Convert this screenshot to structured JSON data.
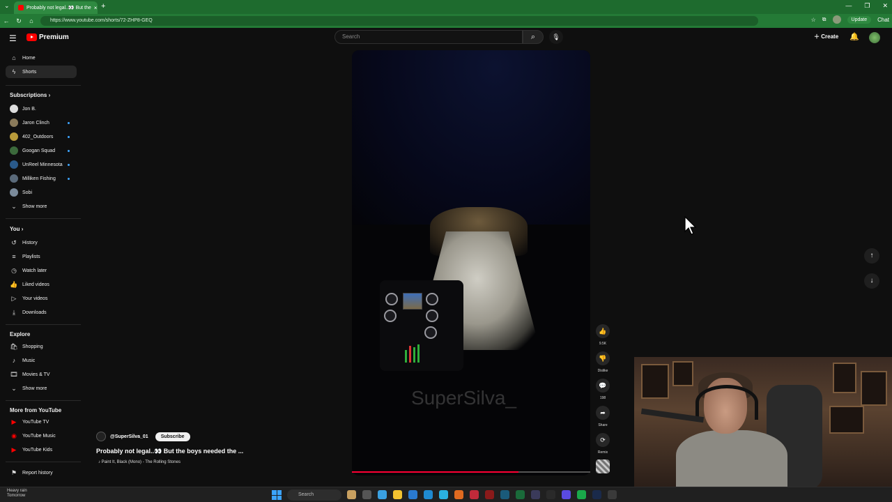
{
  "browser": {
    "tab_title": "Probably not legal..👀 But the",
    "tab_close": "×",
    "new_tab": "+",
    "url": "https://www.youtube.com/shorts/72-ZHP8-GEQ",
    "update_label": "Update",
    "chat_label": "Chat"
  },
  "header": {
    "logo_text": "Premium",
    "search_placeholder": "Search",
    "create_label": "Create"
  },
  "sidebar": {
    "home": "Home",
    "shorts": "Shorts",
    "subscriptions_title": "Subscriptions",
    "subscriptions": [
      {
        "name": "Jon B.",
        "dot": false
      },
      {
        "name": "Jaron Clinch",
        "dot": true
      },
      {
        "name": "402_Outdoors",
        "dot": true
      },
      {
        "name": "Googan Squad",
        "dot": true
      },
      {
        "name": "UnReel Minnesota",
        "dot": true
      },
      {
        "name": "Milliken Fishing",
        "dot": true
      },
      {
        "name": "Sobi",
        "dot": false
      }
    ],
    "show_more": "Show more",
    "you_title": "You",
    "you_items": [
      "History",
      "Playlists",
      "Watch later",
      "Liked videos",
      "Your videos",
      "Downloads"
    ],
    "explore_title": "Explore",
    "explore_items": [
      "Shopping",
      "Music",
      "Movies & TV"
    ],
    "explore_show_more": "Show more",
    "more_title": "More from YouTube",
    "more_items": [
      "YouTube TV",
      "YouTube Music",
      "YouTube Kids"
    ],
    "report_history": "Report history"
  },
  "short": {
    "watermark": "SuperSilva_",
    "channel": "@SuperSilva_01",
    "subscribe": "Subscribe",
    "title": "Probably not legal..👀 But the boys needed the ...",
    "song": "Paint It, Black (Mono) - The Rolling Stones",
    "progress": 0.7
  },
  "actions": {
    "likes": "9.5K",
    "dislike": "Dislike",
    "comments": "198",
    "share": "Share",
    "remix": "Remix"
  },
  "taskbar": {
    "weather_line1": "Heavy rain",
    "weather_line2": "Tomorrow",
    "search": "Search"
  }
}
